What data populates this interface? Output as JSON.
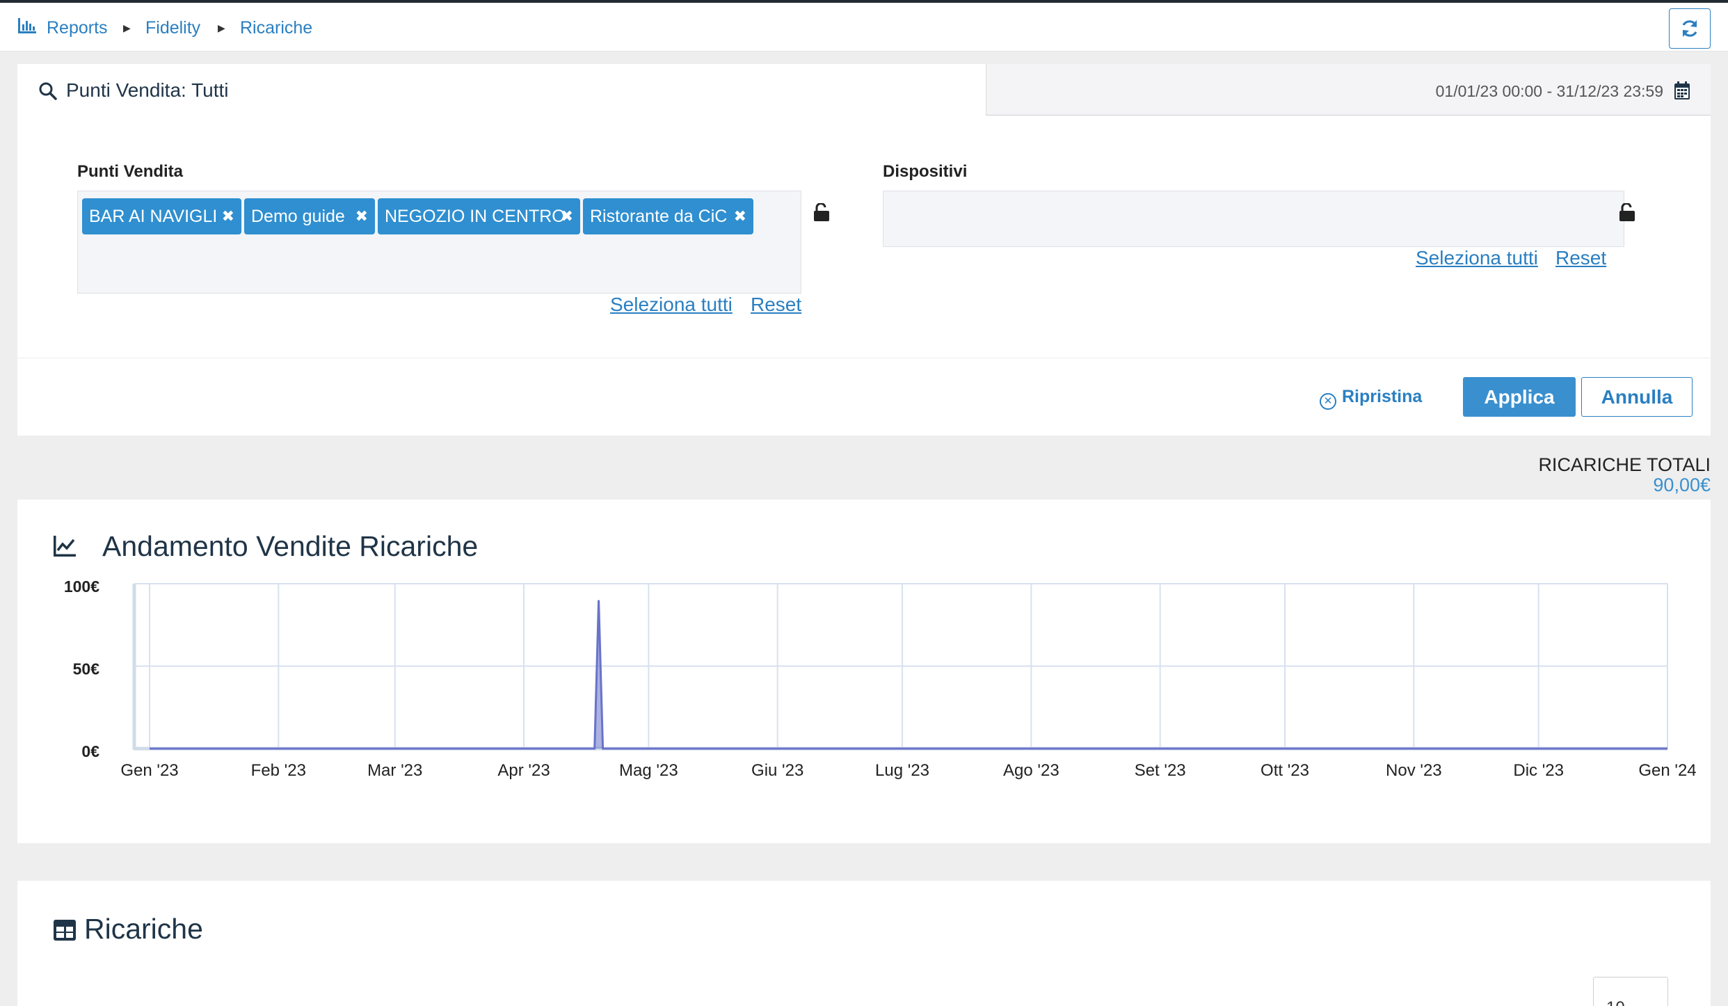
{
  "breadcrumb": {
    "items": [
      "Reports",
      "Fidelity",
      "Ricariche"
    ]
  },
  "filters": {
    "search_label": "Punti Vendita: Tutti",
    "date_range": "01/01/23 00:00 - 31/12/23 23:59",
    "punti_vendita": {
      "label": "Punti Vendita",
      "tags": [
        "BAR AI NAVIGLI",
        "Demo guide",
        "NEGOZIO IN CENTRO",
        "Ristorante da CiC"
      ]
    },
    "dispositivi": {
      "label": "Dispositivi",
      "tags": []
    },
    "select_all_label": "Seleziona tutti",
    "reset_label": "Reset",
    "ripristina_label": "Ripristina",
    "apply_label": "Applica",
    "cancel_label": "Annulla"
  },
  "totals": {
    "title": "RICARICHE TOTALI",
    "value": "90,00€"
  },
  "chart_panel": {
    "title": "Andamento Vendite Ricariche"
  },
  "chart_data": {
    "type": "area",
    "title": "Andamento Vendite Ricariche",
    "xlabel": "",
    "ylabel": "",
    "x_ticks": [
      "Gen '23",
      "Feb '23",
      "Mar '23",
      "Apr '23",
      "Mag '23",
      "Giu '23",
      "Lug '23",
      "Ago '23",
      "Set '23",
      "Ott '23",
      "Nov '23",
      "Dic '23",
      "Gen '24"
    ],
    "y_ticks": [
      "0€",
      "50€",
      "100€"
    ],
    "ylim": [
      0,
      100
    ],
    "x": [
      "2023-01-01",
      "2023-04-18",
      "2023-04-19",
      "2023-04-20",
      "2024-01-01"
    ],
    "values": [
      0,
      0,
      90,
      0,
      0
    ],
    "color": "#6873c9",
    "grid": true
  },
  "table_panel": {
    "title": "Ricariche",
    "page_size": "10"
  },
  "colors": {
    "accent": "#2a7fc1",
    "tag_bg": "#2f8fd0",
    "title": "#1f3447"
  }
}
